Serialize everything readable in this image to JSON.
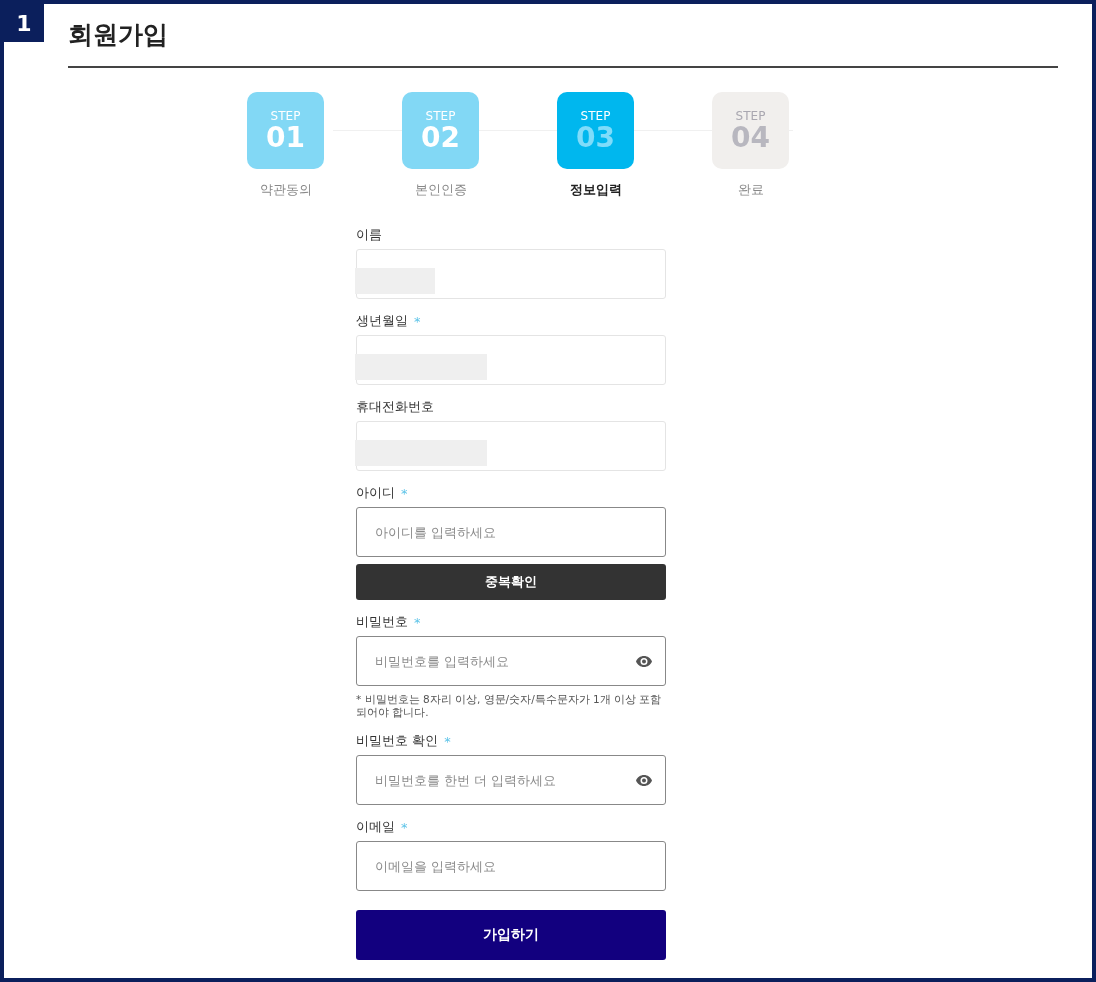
{
  "badge": "1",
  "title": "회원가입",
  "steps": [
    {
      "caption": "STEP",
      "number": "01",
      "label": "약관동의",
      "completed": true,
      "selected": false
    },
    {
      "caption": "STEP",
      "number": "02",
      "label": "본인인증",
      "completed": true,
      "selected": false
    },
    {
      "caption": "STEP",
      "number": "03",
      "label": "정보입력",
      "completed": false,
      "selected": true
    },
    {
      "caption": "STEP",
      "number": "04",
      "label": "완료",
      "completed": false,
      "selected": false
    }
  ],
  "fields": [
    {
      "label": "이름",
      "kind": "redacted"
    },
    {
      "label": "생년월일",
      "asterisk": "*",
      "kind": "redacted"
    },
    {
      "label": "휴대전화번호",
      "kind": "redacted"
    },
    {
      "label": "아이디",
      "asterisk": "*",
      "kind": "text",
      "placeholder": "아이디를 입력하세요",
      "button": "중복확인"
    },
    {
      "label": "비밀번호",
      "asterisk": "*",
      "kind": "password",
      "placeholder": "비밀번호를 입력하세요",
      "hint": "* 비밀번호는 8자리 이상, 영문/숫자/특수문자가 1개 이상 포함되어야 합니다."
    },
    {
      "label": "비밀번호 확인",
      "asterisk": "*",
      "kind": "password",
      "placeholder": "비밀번호를 한번 더 입력하세요"
    },
    {
      "label": "이메일",
      "asterisk": "*",
      "kind": "text",
      "placeholder": "이메일을 입력하세요"
    }
  ],
  "submit": "가입하기"
}
